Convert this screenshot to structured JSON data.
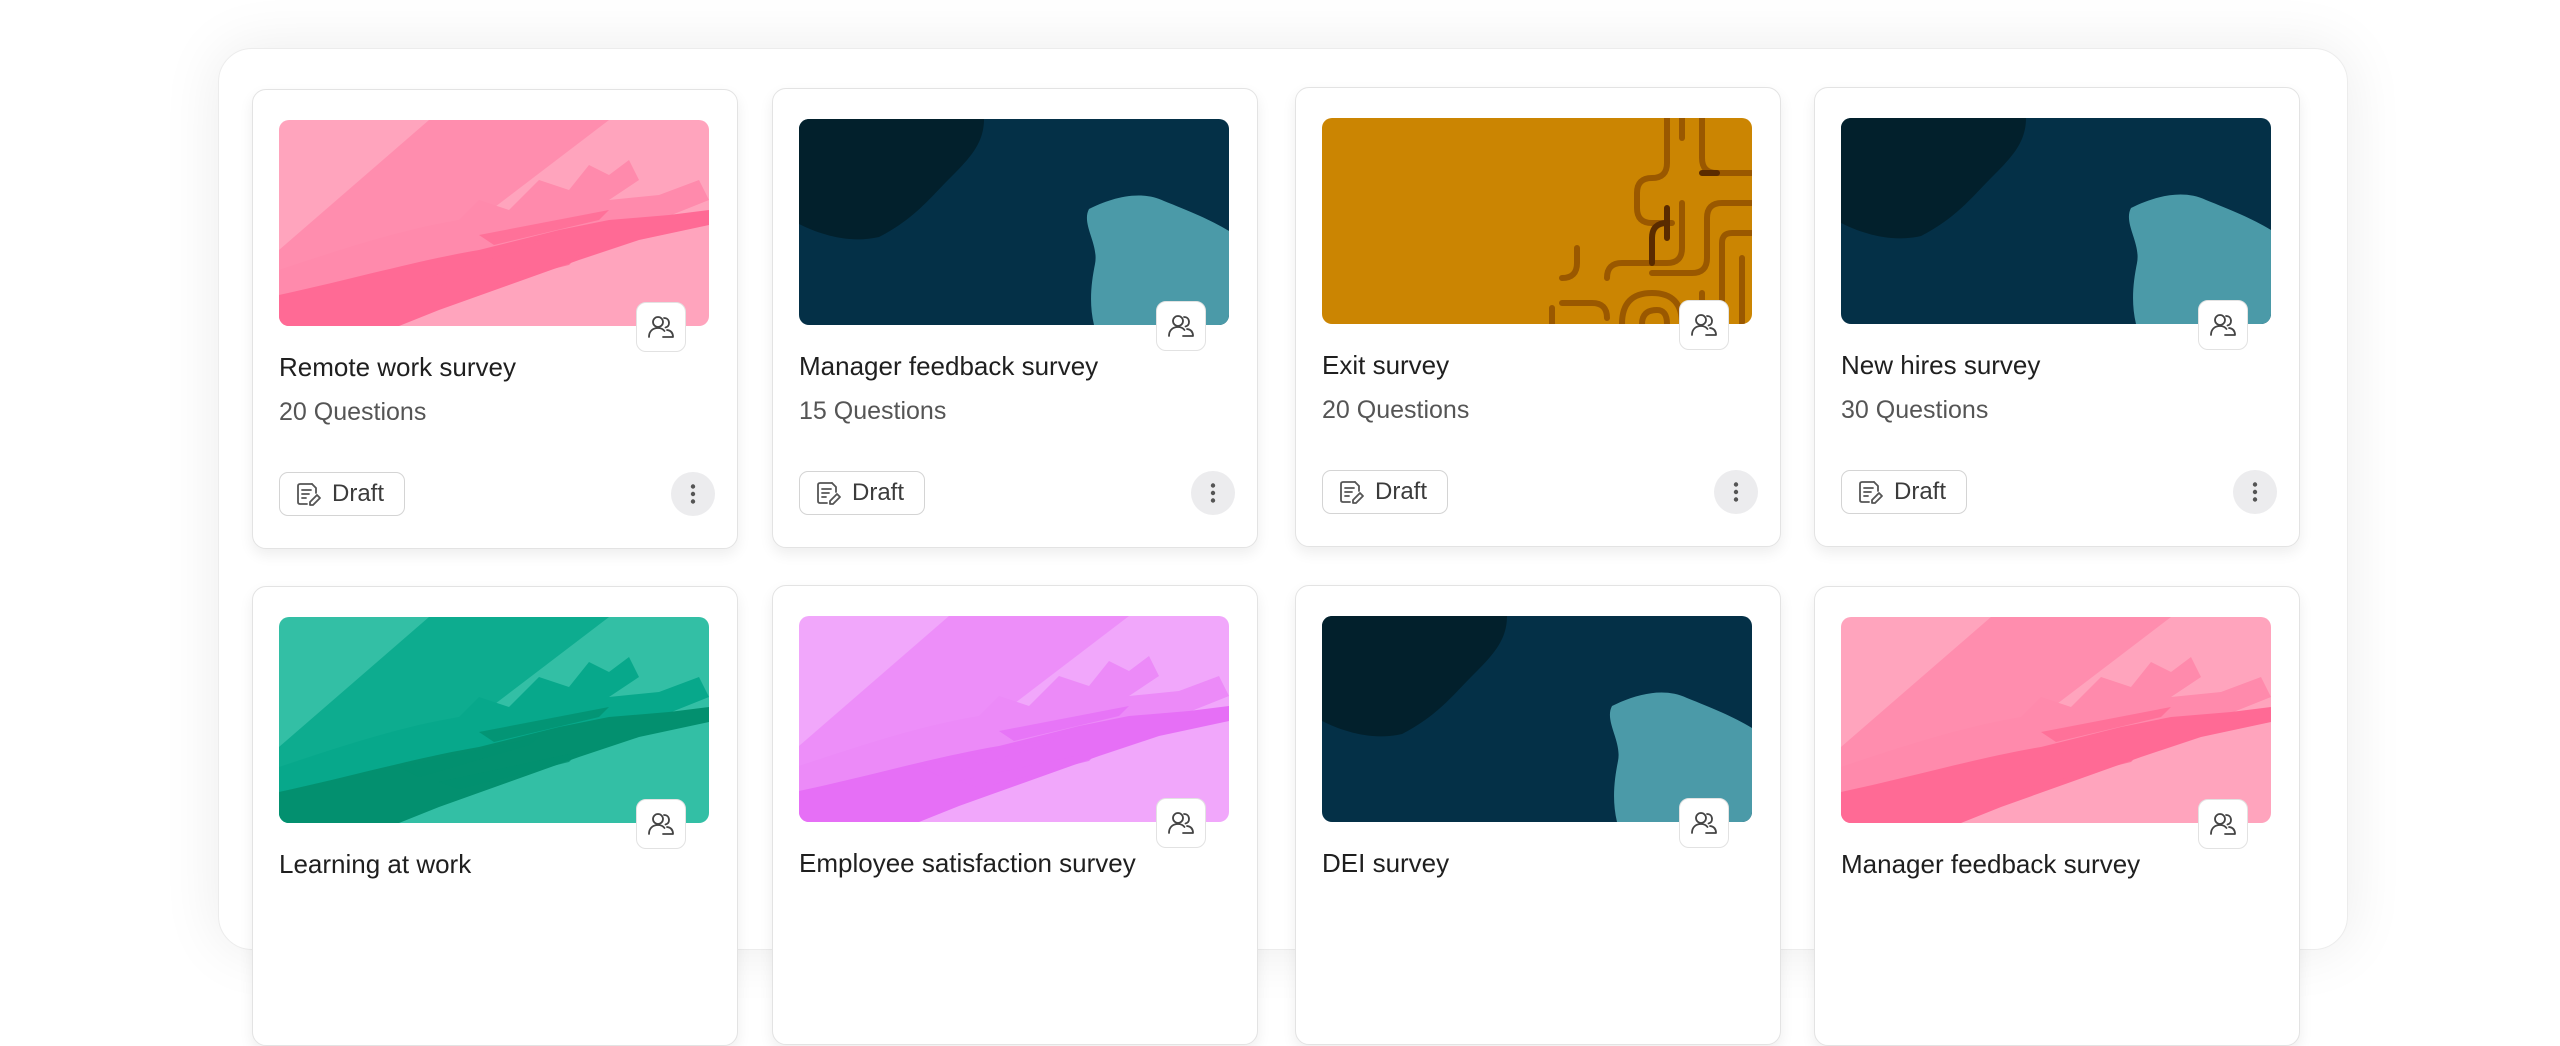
{
  "surveys": [
    {
      "title": "Remote work survey",
      "questions": "20 Questions",
      "status": "Draft",
      "theme": "pink-brush",
      "icon": "people-icon"
    },
    {
      "title": "Manager feedback survey",
      "questions": "15 Questions",
      "status": "Draft",
      "theme": "navy-blobs",
      "icon": "people-icon"
    },
    {
      "title": "Exit survey",
      "questions": "20 Questions",
      "status": "Draft",
      "theme": "gold-maze",
      "icon": "people-icon"
    },
    {
      "title": "New hires survey",
      "questions": "30 Questions",
      "status": "Draft",
      "theme": "navy-blobs",
      "icon": "people-icon"
    },
    {
      "title": "Learning at work",
      "questions": "",
      "status": "",
      "theme": "green-brush",
      "icon": "people-icon"
    },
    {
      "title": "Employee satisfaction survey",
      "questions": "",
      "status": "",
      "theme": "violet-brush",
      "icon": "people-icon"
    },
    {
      "title": "DEI survey",
      "questions": "",
      "status": "",
      "theme": "navy-blobs",
      "icon": "people-icon"
    },
    {
      "title": "Manager feedback survey",
      "questions": "",
      "status": "",
      "theme": "pink-brush",
      "icon": "people-icon"
    }
  ],
  "colors": {
    "pink": [
      "#ffa4bd",
      "#ff8aac",
      "#ff6a95"
    ],
    "navy": [
      "#043047",
      "#02202c",
      "#4b9aa8"
    ],
    "gold": [
      "#cb8502",
      "#8a4a00"
    ],
    "green": [
      "#33bfa5",
      "#07a88b",
      "#03906f"
    ],
    "violet": [
      "#f1a7fb",
      "#ec8af8",
      "#e66ff6"
    ]
  }
}
